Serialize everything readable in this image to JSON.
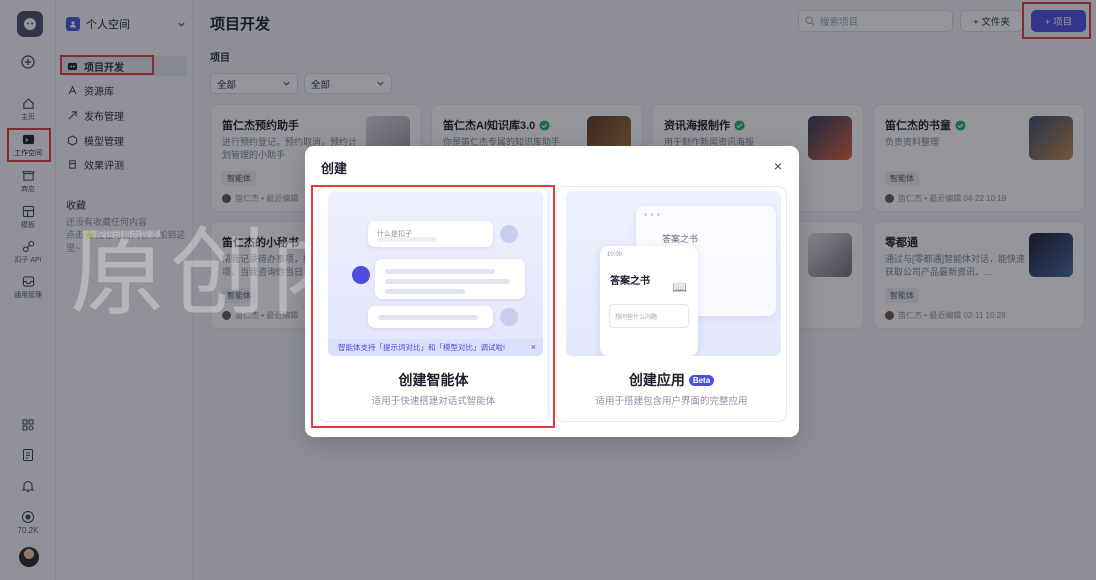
{
  "rail": {
    "items": [
      {
        "label": "主页"
      },
      {
        "label": "工作空间"
      },
      {
        "label": "商店"
      },
      {
        "label": "模板"
      },
      {
        "label": "扣子 API"
      },
      {
        "label": "通用管理"
      }
    ],
    "count": "70.2K"
  },
  "sidebar": {
    "space": "个人空间",
    "nav": [
      {
        "label": "项目开发"
      },
      {
        "label": "资源库"
      },
      {
        "label": "发布管理"
      },
      {
        "label": "模型管理"
      },
      {
        "label": "效果评测"
      }
    ],
    "fav_title": "收藏",
    "fav_empty": "还没有收藏任何内容\n点击⭐按钮可将内容添加到这里~"
  },
  "header": {
    "title": "项目开发",
    "search_placeholder": "搜索项目",
    "folder_label": "+ 文件夹",
    "new_label": "+ 项目"
  },
  "section_label": "项目",
  "filters": [
    "全部",
    "全部"
  ],
  "cards": [
    {
      "title": "笛仁杰预约助手",
      "desc": "进行预约登记，预约取消，预约计划管理的小助手",
      "tag": "智能体",
      "meta": "笛仁杰 • 最近编辑"
    },
    {
      "title": "笛仁杰AI知识库3.0",
      "desc": "你是笛仁杰专属的知识库助手",
      "tag": "",
      "meta": ""
    },
    {
      "title": "资讯海报制作",
      "desc": "用于制作新闻资讯海报",
      "tag": "",
      "meta": ""
    },
    {
      "title": "笛仁杰的书童",
      "desc": "负责资料整理",
      "tag": "智能体",
      "meta": "笛仁杰 • 最近编辑 04-22 10:19"
    },
    {
      "title": "笛仁杰的小秘书",
      "desc": "帮我记录待办事项，提醒我的事项，当我咨询你当日",
      "tag": "智能体",
      "meta": "笛仁杰 • 最近编辑"
    },
    {
      "title": "零都通",
      "desc": "通过与[零都通]智能体对话，能快速获取公司产品最新资讯，…",
      "tag": "智能体",
      "meta": "笛仁杰 • 最近编辑 02-11 10:28"
    }
  ],
  "watermark": "原创内容 笛仁杰",
  "modal": {
    "title": "创建",
    "close": "×",
    "options": [
      {
        "label": "创建智能体",
        "desc": "适用于快速搭建对话式智能体",
        "preview_prompt": "什么是扣子",
        "tip": "智能体支持「提示词对比」和「模型对比」调试啦!",
        "tip_close": "×"
      },
      {
        "label": "创建应用",
        "beta": "Beta",
        "desc": "适用于搭建包含用户界面的完整应用",
        "preview_title": "答案之书",
        "preview_time": "10:00",
        "preview_input": "想问些什么问题"
      }
    ]
  },
  "colors": {
    "accent": "#4c4fe0",
    "highlight_box": "#e23b3b",
    "verified": "#22b35e"
  }
}
